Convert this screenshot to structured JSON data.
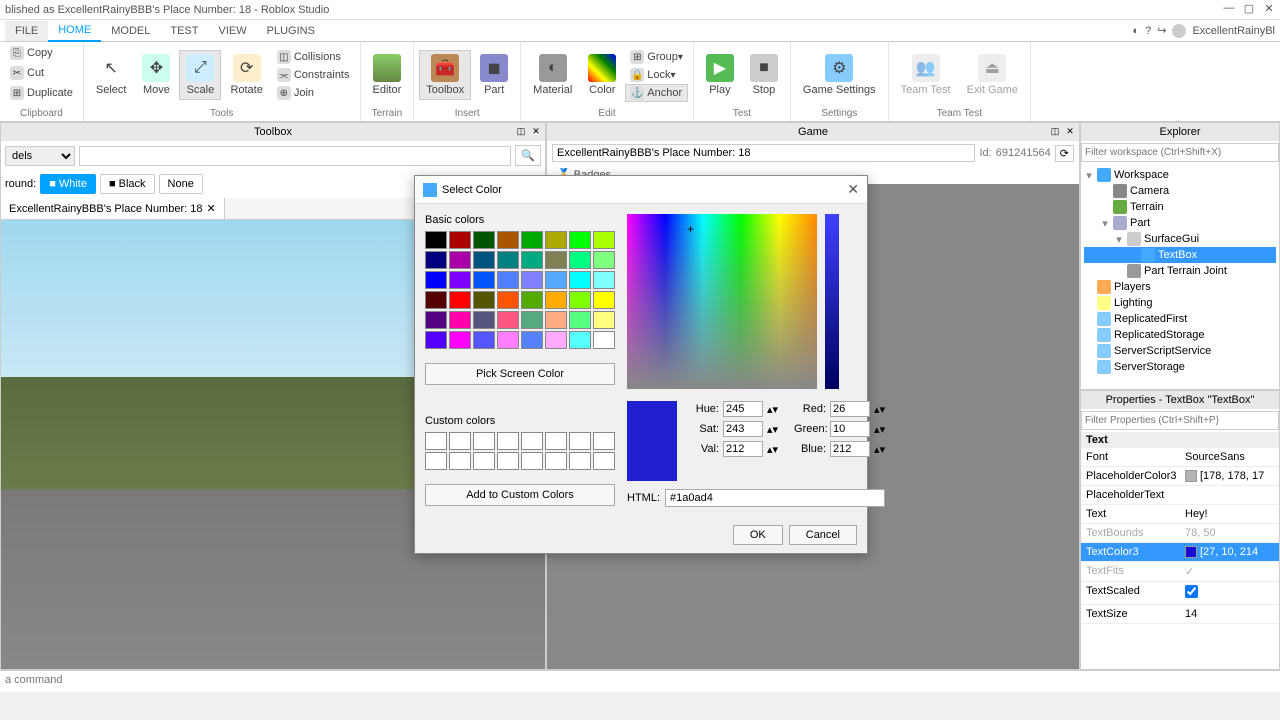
{
  "window": {
    "title": "blished as ExcellentRainyBBB's Place Number: 18 - Roblox Studio",
    "user": "ExcellentRainyBl"
  },
  "tabs": [
    "FILE",
    "HOME",
    "MODEL",
    "TEST",
    "VIEW",
    "PLUGINS"
  ],
  "active_tab": "HOME",
  "ribbon": {
    "clipboard": {
      "label": "Clipboard",
      "copy": "Copy",
      "cut": "Cut",
      "duplicate": "Duplicate"
    },
    "tools": {
      "label": "Tools",
      "select": "Select",
      "move": "Move",
      "scale": "Scale",
      "rotate": "Rotate",
      "collisions": "Collisions",
      "constraints": "Constraints",
      "join": "Join"
    },
    "terrain": {
      "label": "Terrain",
      "editor": "Editor"
    },
    "insert": {
      "label": "Insert",
      "toolbox": "Toolbox",
      "part": "Part"
    },
    "edit": {
      "label": "Edit",
      "material": "Material",
      "color": "Color",
      "group": "Group",
      "lock": "Lock",
      "anchor": "Anchor"
    },
    "test": {
      "label": "Test",
      "play": "Play",
      "stop": "Stop"
    },
    "settings": {
      "label": "Settings",
      "game": "Game Settings"
    },
    "teamtest": {
      "label": "Team Test",
      "team": "Team Test",
      "exit": "Exit Game"
    }
  },
  "toolbox": {
    "title": "Toolbox",
    "dropdown": "dels",
    "bg_label": "round:",
    "white": "White",
    "black": "Black",
    "none": "None",
    "open_tab": "ExcellentRainyBBB's Place Number: 18"
  },
  "game": {
    "title": "Game",
    "place": "ExcellentRainyBBB's Place Number: 18",
    "id_label": "Id:",
    "id": "691241564",
    "badges": "Badges"
  },
  "explorer": {
    "title": "Explorer",
    "filter": "Filter workspace (Ctrl+Shift+X)",
    "items": [
      "Workspace",
      "Camera",
      "Terrain",
      "Part",
      "SurfaceGui",
      "TextBox",
      "Part Terrain Joint",
      "Players",
      "Lighting",
      "ReplicatedFirst",
      "ReplicatedStorage",
      "ServerScriptService",
      "ServerStorage"
    ]
  },
  "properties": {
    "title": "Properties - TextBox \"TextBox\"",
    "filter": "Filter Properties (Ctrl+Shift+P)",
    "section": "Text",
    "rows": {
      "Font": "SourceSans",
      "PlaceholderColor3": "[178, 178, 17",
      "PlaceholderText": "",
      "Text": "Hey!",
      "TextBounds": "78, 50",
      "TextColor3": "[27, 10, 214",
      "TextFits": "",
      "TextScaled": "",
      "TextSize": "14"
    }
  },
  "dialog": {
    "title": "Select Color",
    "basic": "Basic colors",
    "pick": "Pick Screen Color",
    "custom": "Custom colors",
    "add": "Add to Custom Colors",
    "hue_l": "Hue:",
    "sat_l": "Sat:",
    "val_l": "Val:",
    "red_l": "Red:",
    "green_l": "Green:",
    "blue_l": "Blue:",
    "hue": "245",
    "sat": "243",
    "val": "212",
    "red": "26",
    "green": "10",
    "blue": "212",
    "html_l": "HTML:",
    "html": "#1a0ad4",
    "ok": "OK",
    "cancel": "Cancel",
    "basic_colors": [
      "#000000",
      "#aa0000",
      "#005500",
      "#aa5500",
      "#00aa00",
      "#aaaa00",
      "#00ff00",
      "#aaff00",
      "#000080",
      "#aa00aa",
      "#005580",
      "#008080",
      "#00aa80",
      "#808055",
      "#00ff80",
      "#80ff80",
      "#0000ff",
      "#8000ff",
      "#0055ff",
      "#5080ff",
      "#8080ff",
      "#55aaff",
      "#00ffff",
      "#80ffff",
      "#550000",
      "#ff0000",
      "#555500",
      "#ff5500",
      "#55aa00",
      "#ffaa00",
      "#80ff00",
      "#ffff00",
      "#550080",
      "#ff00aa",
      "#555580",
      "#ff5580",
      "#55aa80",
      "#ffaa80",
      "#55ff80",
      "#ffff80",
      "#5500ff",
      "#ff00ff",
      "#5555ff",
      "#ff80ff",
      "#5580ff",
      "#ffaaff",
      "#55ffff",
      "#ffffff"
    ]
  },
  "status": "a command"
}
